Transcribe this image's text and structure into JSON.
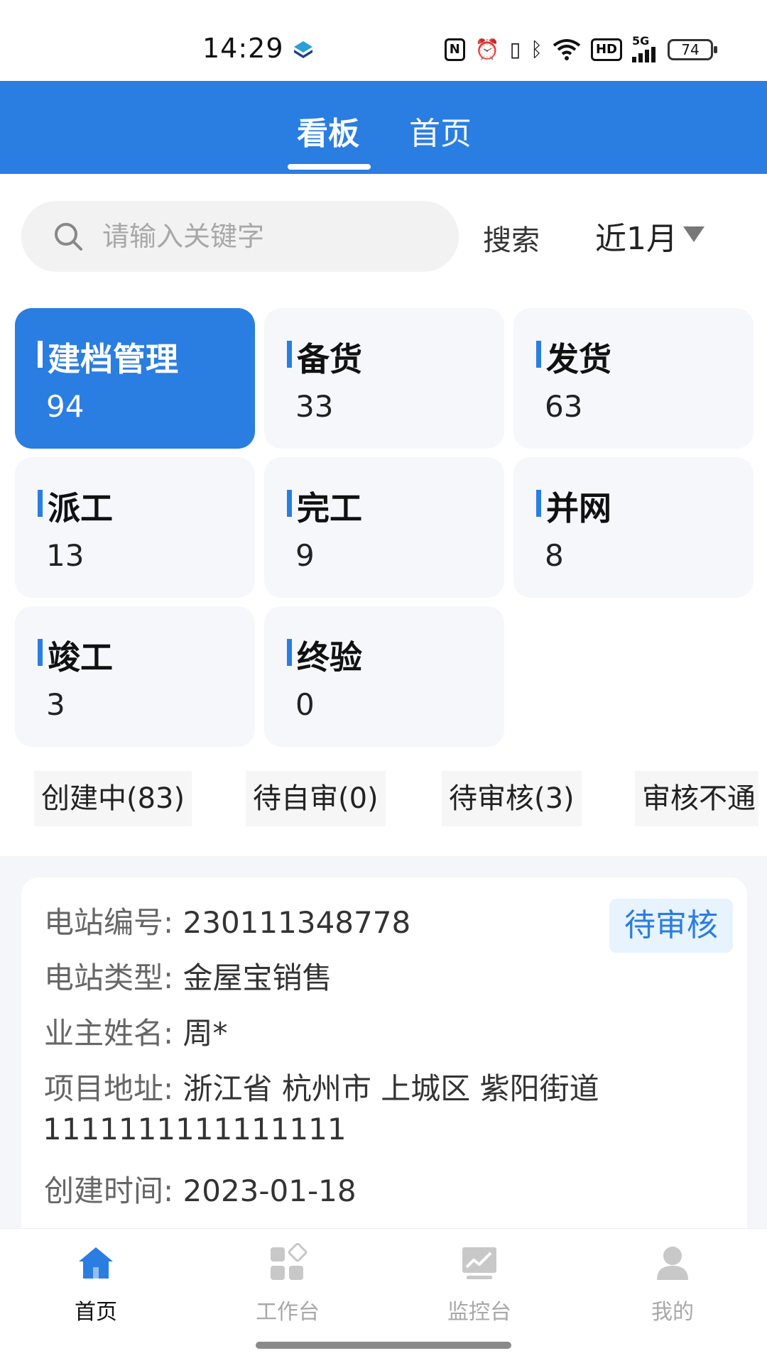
{
  "status_bar": {
    "time": "14:29",
    "network": "5G",
    "hd": "HD",
    "battery": "74"
  },
  "header": {
    "tabs": [
      {
        "label": "看板",
        "active": true
      },
      {
        "label": "首页",
        "active": false
      }
    ]
  },
  "search": {
    "placeholder": "请输入关键字",
    "button_label": "搜索",
    "period": "近1月"
  },
  "stages": [
    {
      "label": "建档管理",
      "count": "94",
      "active": true
    },
    {
      "label": "备货",
      "count": "33"
    },
    {
      "label": "发货",
      "count": "63"
    },
    {
      "label": "派工",
      "count": "13"
    },
    {
      "label": "完工",
      "count": "9"
    },
    {
      "label": "并网",
      "count": "8"
    },
    {
      "label": "竣工",
      "count": "3"
    },
    {
      "label": "终验",
      "count": "0"
    }
  ],
  "status_filters": [
    {
      "label": "创建中(83)"
    },
    {
      "label": "待自审(0)"
    },
    {
      "label": "待审核(3)"
    },
    {
      "label": "审核不通"
    }
  ],
  "record": {
    "status": "待审核",
    "station_no_label": "电站编号:",
    "station_no": "230111348778",
    "station_type_label": "电站类型:",
    "station_type": "金屋宝销售",
    "owner_label": "业主姓名:",
    "owner": "周*",
    "address_label": "项目地址:",
    "address_line1": "浙江省 杭州市 上城区 紫阳街道",
    "address_line2": "1111111111111111",
    "created_label": "创建时间:",
    "created": "2023-01-18"
  },
  "bottom_nav": {
    "items": [
      {
        "label": "首页",
        "icon": "home-icon",
        "active": true
      },
      {
        "label": "工作台",
        "icon": "workbench-icon"
      },
      {
        "label": "监控台",
        "icon": "monitor-icon"
      },
      {
        "label": "我的",
        "icon": "profile-icon"
      }
    ]
  },
  "colors": {
    "primary": "#2a7de1",
    "card_bg": "#f5f7fb",
    "badge_bg": "#e7f3fd"
  }
}
